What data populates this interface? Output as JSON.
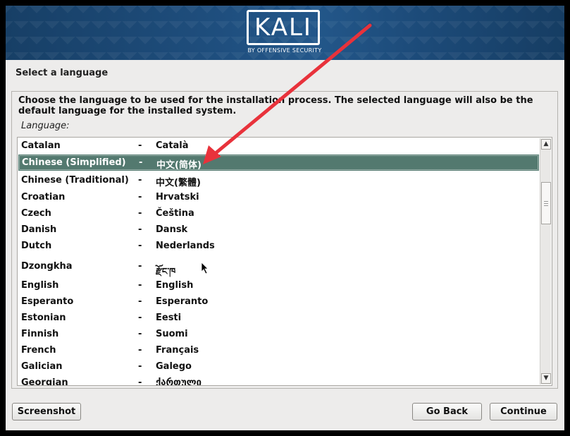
{
  "brand": {
    "logo_text": "KALI",
    "logo_subtitle": "BY OFFENSIVE SECURITY"
  },
  "section_title": "Select a language",
  "description": "Choose the language to be used for the installation process. The selected language will also be the default language for the installed system.",
  "list_label": "Language:",
  "languages": [
    {
      "name": "Catalan",
      "native": "Català"
    },
    {
      "name": "Chinese (Simplified)",
      "native": "中文(简体)",
      "selected": true
    },
    {
      "name": "Chinese (Traditional)",
      "native": "中文(繁體)"
    },
    {
      "name": "Croatian",
      "native": "Hrvatski"
    },
    {
      "name": "Czech",
      "native": "Čeština"
    },
    {
      "name": "Danish",
      "native": "Dansk"
    },
    {
      "name": "Dutch",
      "native": "Nederlands"
    },
    {
      "name": "Dzongkha",
      "native": "རྫོང་ཁ"
    },
    {
      "name": "English",
      "native": "English"
    },
    {
      "name": "Esperanto",
      "native": "Esperanto"
    },
    {
      "name": "Estonian",
      "native": "Eesti"
    },
    {
      "name": "Finnish",
      "native": "Suomi"
    },
    {
      "name": "French",
      "native": "Français"
    },
    {
      "name": "Galician",
      "native": "Galego"
    },
    {
      "name": "Georgian",
      "native": "ქართული"
    }
  ],
  "separator": "-",
  "buttons": {
    "screenshot": "Screenshot",
    "go_back": "Go Back",
    "continue": "Continue"
  },
  "colors": {
    "selection": "#53796f",
    "annotation_arrow": "#e8323b",
    "banner": "#1f4f7f"
  }
}
